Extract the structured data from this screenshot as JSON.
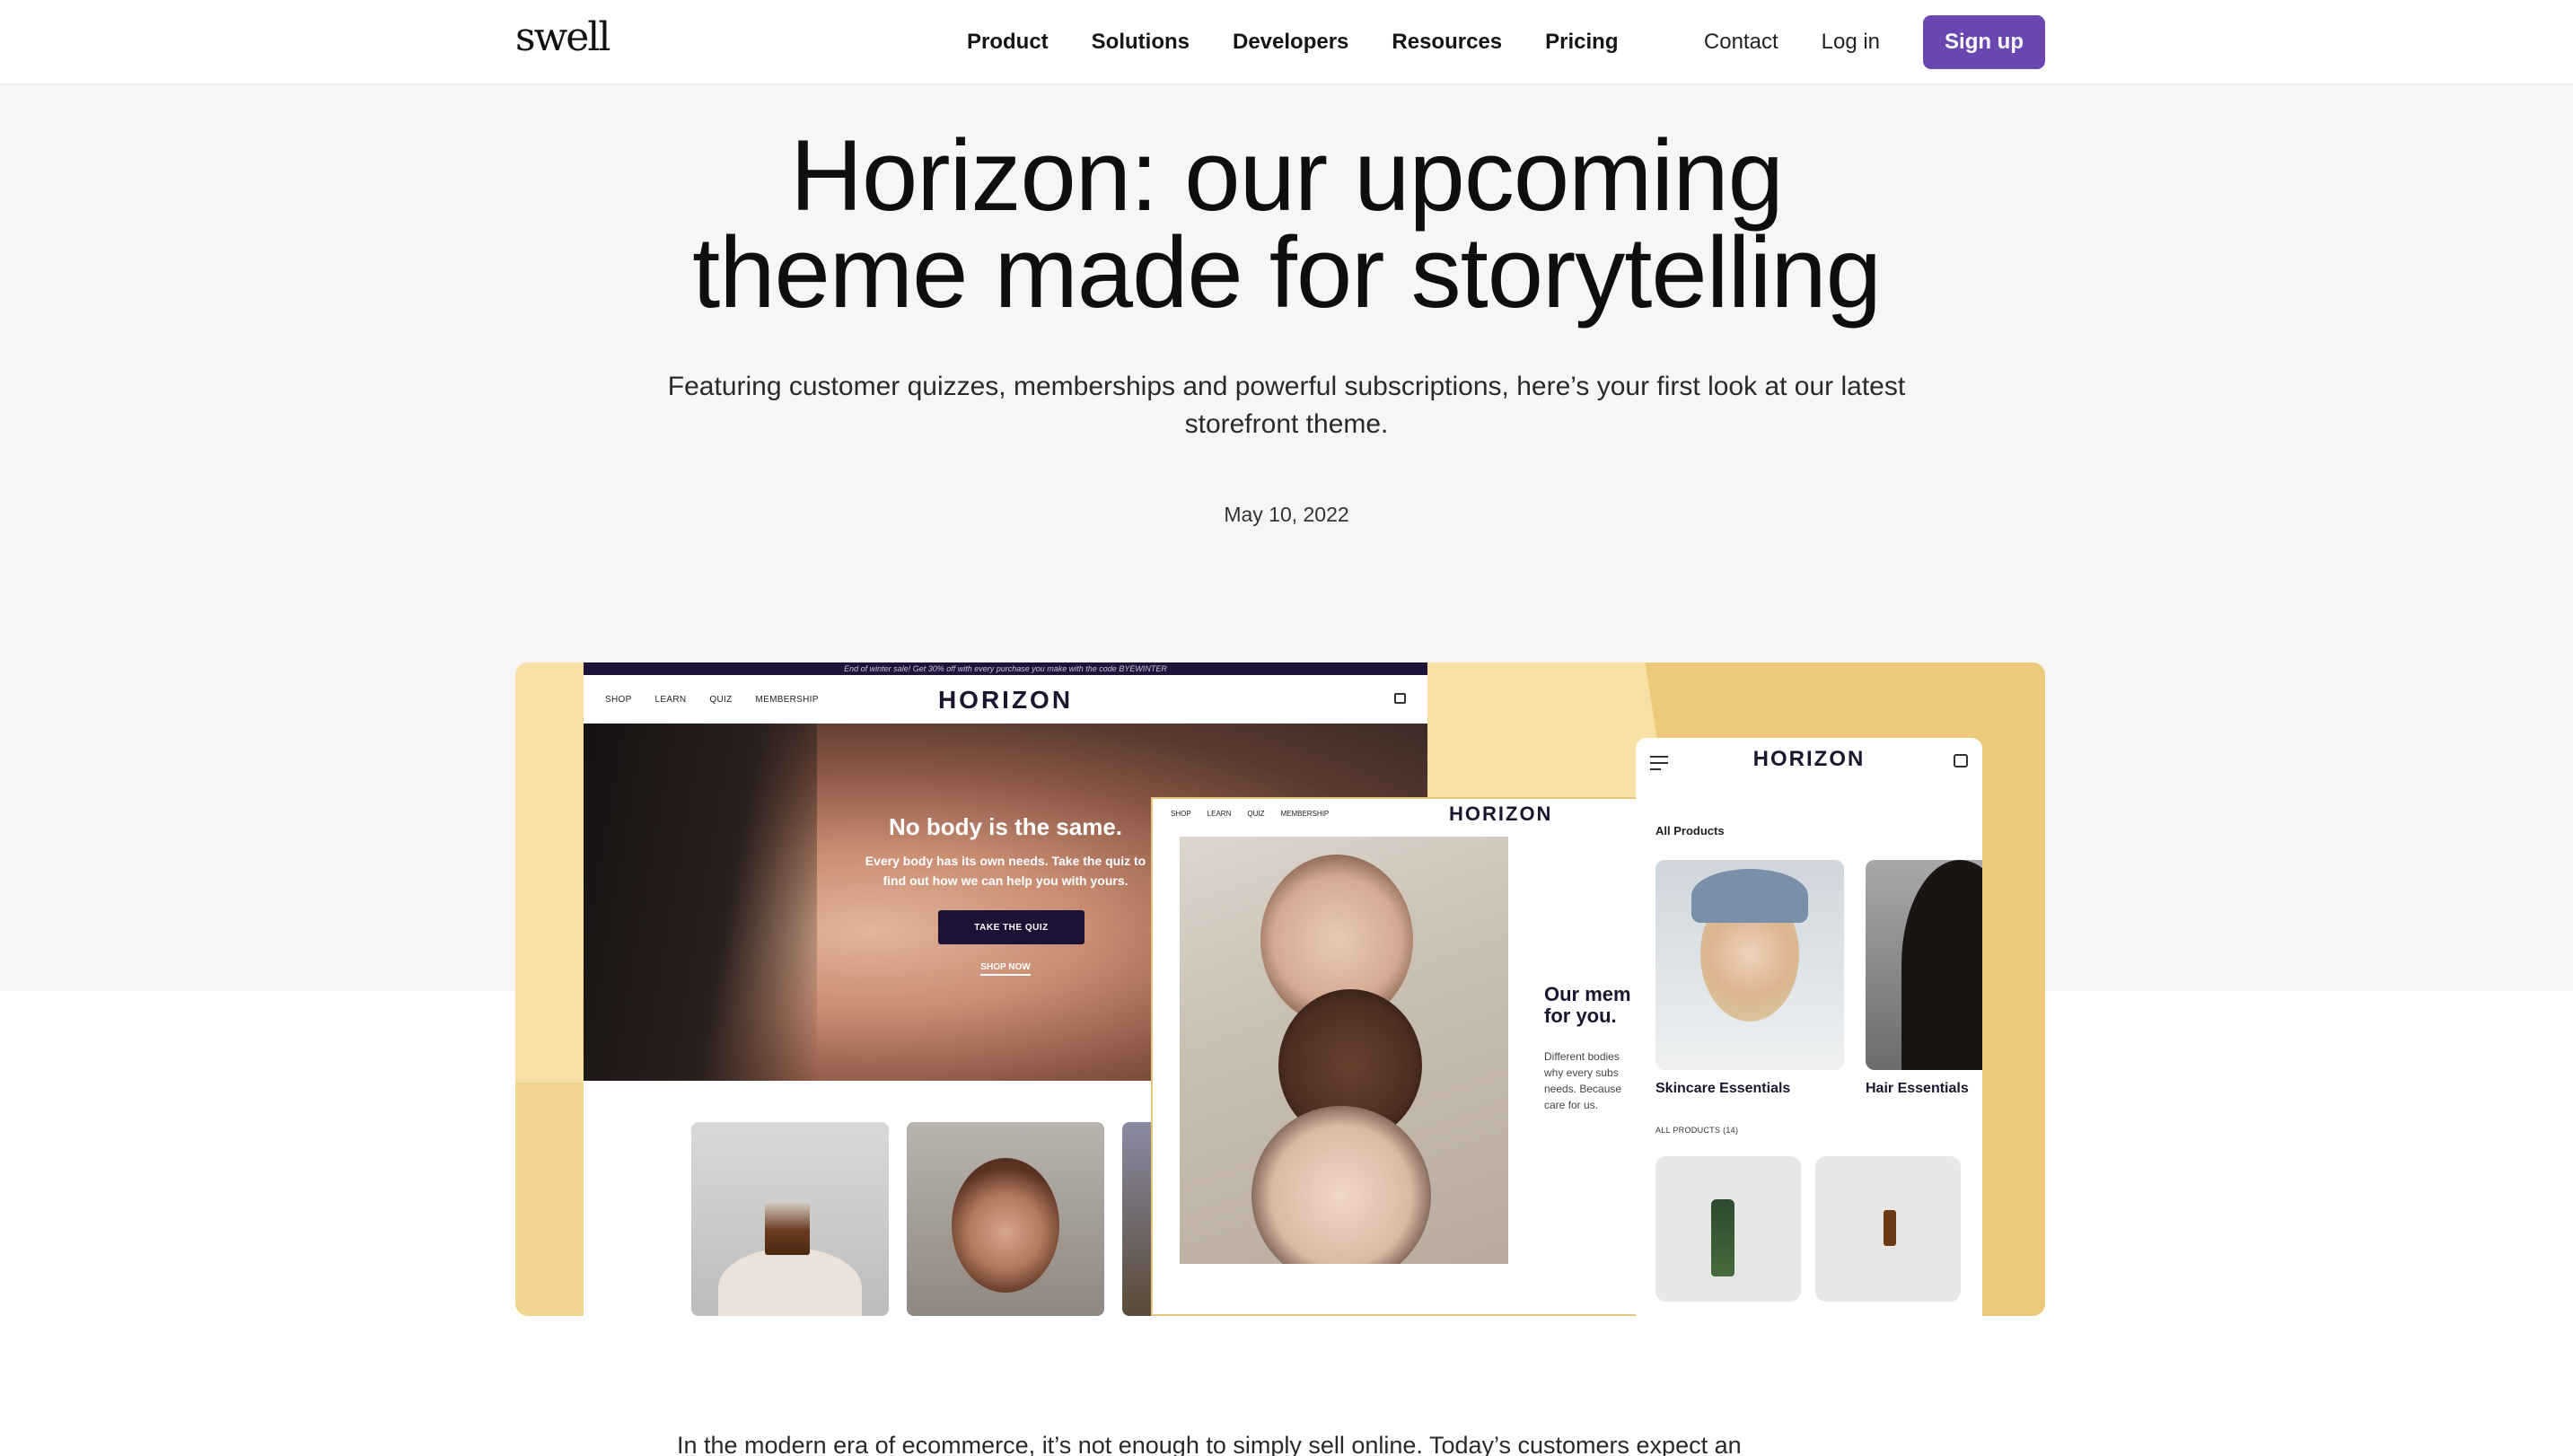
{
  "brand": {
    "logo": "swell",
    "accent": "#6a46b0"
  },
  "nav": {
    "links": [
      "Product",
      "Solutions",
      "Developers",
      "Resources",
      "Pricing"
    ],
    "contact": "Contact",
    "login": "Log in",
    "signup": "Sign up"
  },
  "hero": {
    "title_line1": "Horizon: our upcoming",
    "title_line2": "theme made for storytelling",
    "subtitle": "Featuring customer quizzes, memberships and powerful subscriptions, here’s your first look at our latest storefront theme.",
    "date": "May 10, 2022"
  },
  "feature_image": {
    "desktop": {
      "promo": "End of winter sale! Get 30% off with every purchase you make with the code BYEWINTER",
      "nav_links": [
        "SHOP",
        "LEARN",
        "QUIZ",
        "MEMBERSHIP"
      ],
      "logo": "HORIZON",
      "hero_title": "No body is the same.",
      "hero_sub": "Every body has its own needs. Take the quiz to find out how we can help you with yours.",
      "quiz_button": "TAKE THE QUIZ",
      "shop_link": "SHOP NOW"
    },
    "tablet": {
      "nav_links": [
        "SHOP",
        "LEARN",
        "QUIZ",
        "MEMBERSHIP"
      ],
      "logo": "HORIZON",
      "heading": "Our mem\nfor you.",
      "body": "Different bodies\nwhy every subs\nneeds. Because\ncare for us."
    },
    "mobile": {
      "logo": "HORIZON",
      "all_products": "All Products",
      "card1_label": "Skincare Essentials",
      "card2_label": "Hair Essentials",
      "count_label": "ALL PRODUCTS (14)"
    }
  },
  "article": {
    "intro": "In the modern era of ecommerce, it’s not enough to simply sell online. Today’s customers expect an"
  }
}
